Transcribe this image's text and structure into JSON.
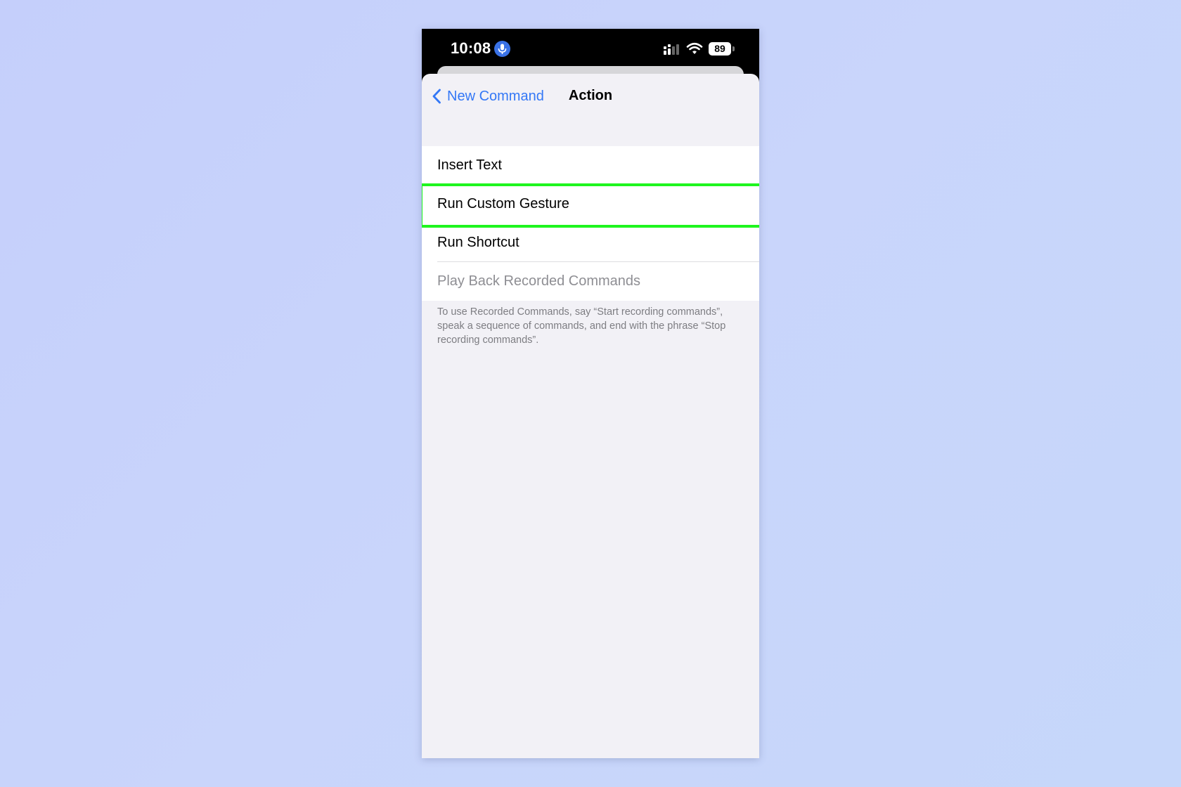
{
  "status_bar": {
    "time": "10:08",
    "battery": "89",
    "icons": [
      "microphone-icon",
      "cellular-signal-icon",
      "wifi-icon",
      "battery-icon"
    ]
  },
  "nav": {
    "back_label": "New Command",
    "title": "Action"
  },
  "actions": {
    "items": [
      {
        "label": "Insert Text"
      },
      {
        "label": "Run Custom Gesture",
        "highlighted": true
      },
      {
        "label": "Run Shortcut"
      },
      {
        "label": "Play Back Recorded Commands",
        "disabled": true
      }
    ],
    "footer": "To use Recorded Commands, say “Start recording commands”, speak a sequence of commands, and end with the phrase “Stop recording commands”."
  },
  "colors": {
    "accent": "#3478f6",
    "highlight": "#1ff51f",
    "sheet_background": "#f2f1f6",
    "page_background": "#c8d3fb"
  }
}
